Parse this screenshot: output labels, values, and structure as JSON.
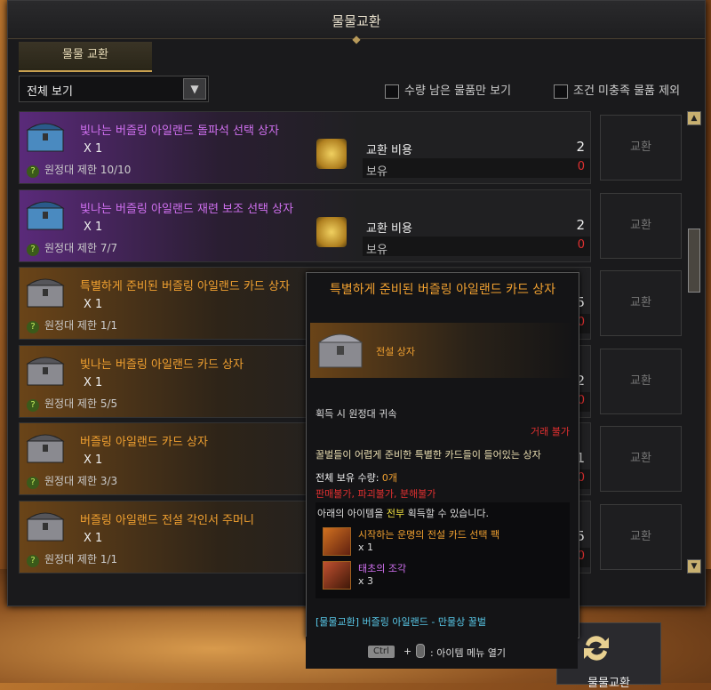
{
  "window": {
    "title": "물물교환"
  },
  "tab": {
    "label": "물물 교환"
  },
  "filter": {
    "dropdown": "전체 보기",
    "check1": "수량 남은 물품만 보기",
    "check2": "조건 미충족 물품 제외"
  },
  "common": {
    "cost_label": "교환 비용",
    "own_label": "보유",
    "exchange_label": "교환"
  },
  "rows": [
    {
      "name": "빛나는 버즐링 아일랜드 돌파석 선택 상자",
      "qty": "X 1",
      "limit": "원정대 제한 10/10",
      "cost": "2",
      "own": "0",
      "color": "#d070f0",
      "grade": "purple"
    },
    {
      "name": "빛나는 버즐링 아일랜드 재련 보조 선택 상자",
      "qty": "X 1",
      "limit": "원정대 제한 7/7",
      "cost": "2",
      "own": "0",
      "color": "#d070f0",
      "grade": "purple"
    },
    {
      "name": "특별하게 준비된 버즐링 아일랜드 카드 상자",
      "qty": "X 1",
      "limit": "원정대 제한 1/1",
      "cost": "5",
      "own": "0",
      "color": "#f0a030",
      "grade": "orange"
    },
    {
      "name": "빛나는 버즐링 아일랜드 카드 상자",
      "qty": "X 1",
      "limit": "원정대 제한 5/5",
      "cost": "2",
      "own": "0",
      "color": "#f0a030",
      "grade": "orange"
    },
    {
      "name": "버즐링 아일랜드 카드 상자",
      "qty": "X 1",
      "limit": "원정대 제한 3/3",
      "cost": "1",
      "own": "0",
      "color": "#f0a030",
      "grade": "orange"
    },
    {
      "name": "버즐링 아일랜드 전설 각인서 주머니",
      "qty": "X 1",
      "limit": "원정대 제한 1/1",
      "cost": "5",
      "own": "0",
      "color": "#f0a030",
      "grade": "orange"
    }
  ],
  "tooltip": {
    "title": "특별하게 준비된 버즐링 아일랜드 카드 상자",
    "type": "전설 상자",
    "bind": "획득 시 원정대 귀속",
    "trade": "거래 불가",
    "desc": "꿀벌들이 어렵게 준비한 특별한 카드들이 들어있는 상자",
    "own_label": "전체 보유 수량:",
    "own_value": "0개",
    "flags": "판매불가, 파괴불가, 분해불가",
    "reward_intro_a": "아래의 아이템을",
    "reward_intro_b": "전부",
    "reward_intro_c": "획득할 수 있습니다.",
    "rewards": [
      {
        "name": "시작하는 운명의 전설 카드 선택 팩",
        "qty": "x 1"
      },
      {
        "name": "태초의 조각",
        "qty": "x 3"
      }
    ],
    "source": "[물물교환] 버즐링 아일랜드 - 만물상 꿀벌"
  },
  "shortcut": {
    "key": "Ctrl",
    "plus": "+",
    "text": ": 아이템 메뉴 열기"
  },
  "bottom_button": {
    "label": "물물교환"
  },
  "colors": {
    "accent": "#f0a030",
    "epic": "#d070f0",
    "warn": "#e03030"
  }
}
